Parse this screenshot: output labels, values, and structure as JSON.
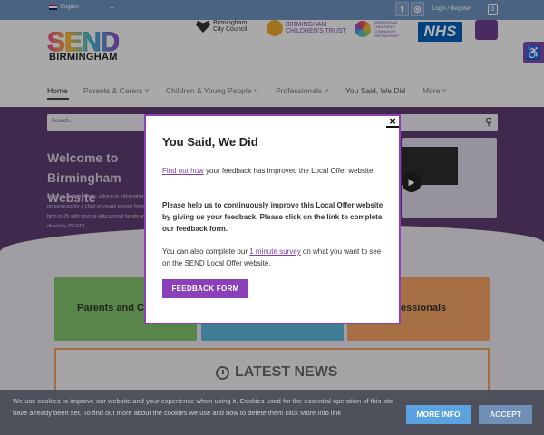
{
  "topbar": {
    "language": "English",
    "login_label": "Login / Register",
    "cart_count": "0",
    "social_icons": [
      "facebook-icon",
      "instagram-icon"
    ]
  },
  "header": {
    "logo_top": "SEND",
    "logo_bottom": "BIRMINGHAM",
    "partners": [
      {
        "name": "Birmingham\nCity Council"
      },
      {
        "name": "BIRMINGHAM\nCHILDREN'S TRUST"
      },
      {
        "name": "BIRMINGHAM\nCHILDREN'S\nCOMMUNITY\nPARTNERSHIP"
      },
      {
        "name": "NHS"
      }
    ]
  },
  "nav": {
    "items": [
      {
        "label": "Home",
        "has_dropdown": false,
        "active": true
      },
      {
        "label": "Parents & Carers",
        "has_dropdown": true
      },
      {
        "label": "Children & Young People",
        "has_dropdown": true
      },
      {
        "label": "Professionals",
        "has_dropdown": true
      },
      {
        "label": "You Said, We Did",
        "has_dropdown": false
      },
      {
        "label": "More",
        "has_dropdown": true
      }
    ]
  },
  "hero": {
    "search_placeholder": "Search...",
    "title": "Welcome to Birmingham\nWebsite",
    "text": "Here you will find help, advice or information on services for a child or young person from birth to 25 with special educational needs or disability (SEND)."
  },
  "cards": [
    {
      "label": "Parents and Carers",
      "color": "#7fbf6a"
    },
    {
      "label": "",
      "color": "#5ab4d6"
    },
    {
      "label": "Professionals",
      "color": "#f0a062"
    }
  ],
  "news": {
    "title": "LATEST NEWS"
  },
  "modal": {
    "title": "You Said, We Did",
    "p1_link": "Find out how",
    "p1_rest": " your feedback has improved the Local Offer website.",
    "p2": "Please help us to continuously improve this Local Offer website by giving us your feedback. Please click on the link to complete our feedback form.",
    "p3_pre": "You can also complete our ",
    "p3_link": "1 minute survey",
    "p3_post": " on what you want to see on the SEND Local Offer website.",
    "button": "FEEDBACK FORM",
    "close_symbol": "×"
  },
  "cookie": {
    "text": "We use cookies to improve our website and your experience when using it. Cookies used for the essential operation of this site have already been set. To find out more about the cookies we use and how to delete them click More Info link",
    "more_info": "MORE INFO",
    "accept": "ACCEPT"
  },
  "colors": {
    "brand_purple": "#8b3fb8",
    "topbar_blue": "#6b8fb8",
    "more_info_blue": "#5aa2e0"
  }
}
